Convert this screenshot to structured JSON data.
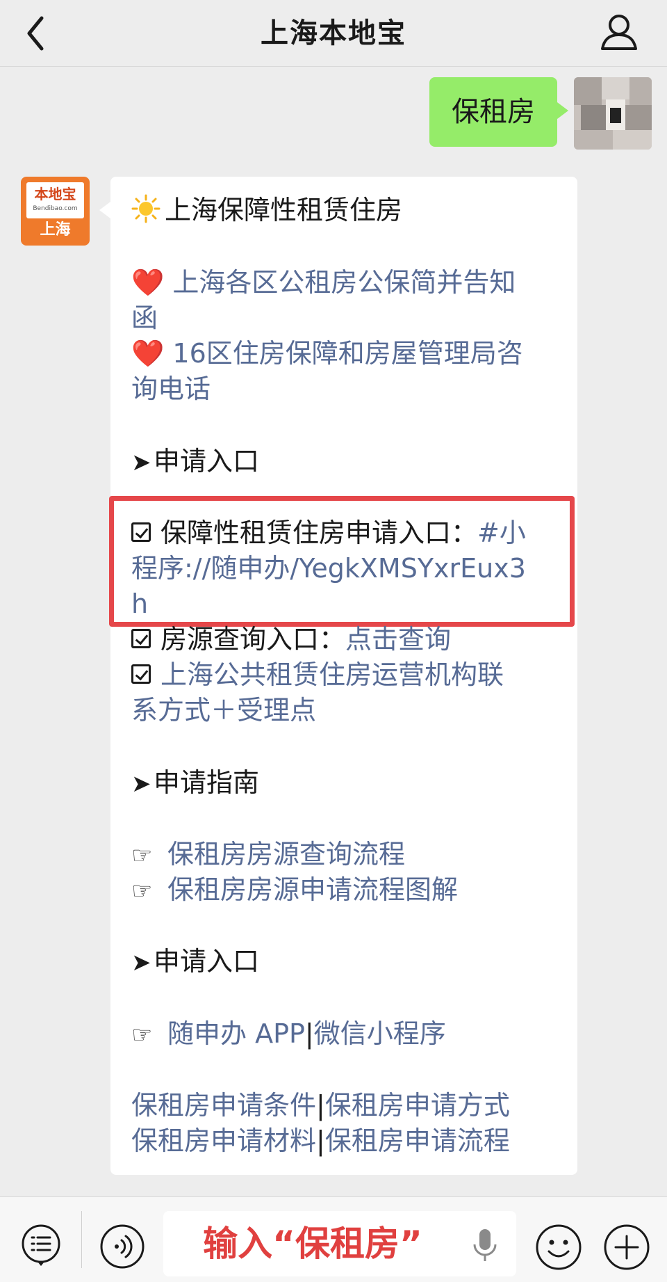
{
  "header": {
    "title": "上海本地宝"
  },
  "user_message": {
    "text": "保租房"
  },
  "bot_avatar": {
    "logo_main": "本地宝",
    "logo_sub": "Bendibao.com",
    "city": "上海"
  },
  "bot_message": {
    "title": "上海保障性租赁住房",
    "notices": [
      {
        "icon": "heart-icon",
        "line1": "上海各区公租房公保简并告知",
        "line2": "函"
      },
      {
        "icon": "heart-icon",
        "line1": "16区住房保障和房屋管理局咨",
        "line2": "询电话"
      }
    ],
    "section1_heading": "申请入口",
    "entry1": {
      "label": "保障性租赁住房申请入口：",
      "link_part1": "#小",
      "link_part2": "程序://随申办/YegkXMSYxrEux3",
      "link_part3": "h"
    },
    "entry2": {
      "label": "房源查询入口：",
      "link": "点击查询"
    },
    "entry3": {
      "link_line1": "上海公共租赁住房运营机构联",
      "link_line2": "系方式＋受理点"
    },
    "section2_heading": "申请指南",
    "guides": [
      {
        "icon": "pointing-hand-icon",
        "text": "保租房房源查询流程"
      },
      {
        "icon": "pointing-hand-icon",
        "text": "保租房房源申请流程图解"
      }
    ],
    "section3_heading": "申请入口",
    "apply_link_app": "随申办 APP",
    "apply_link_mini": "微信小程序",
    "separator": "|",
    "footer_links": [
      "保租房申请条件",
      "保租房申请方式",
      "保租房申请材料",
      "保租房申请流程"
    ],
    "colors": {
      "link": "#576b95",
      "highlight_border": "#e5474a"
    }
  },
  "input_bar": {
    "text": "输入“保租房”",
    "text_color": "#e0403f"
  }
}
